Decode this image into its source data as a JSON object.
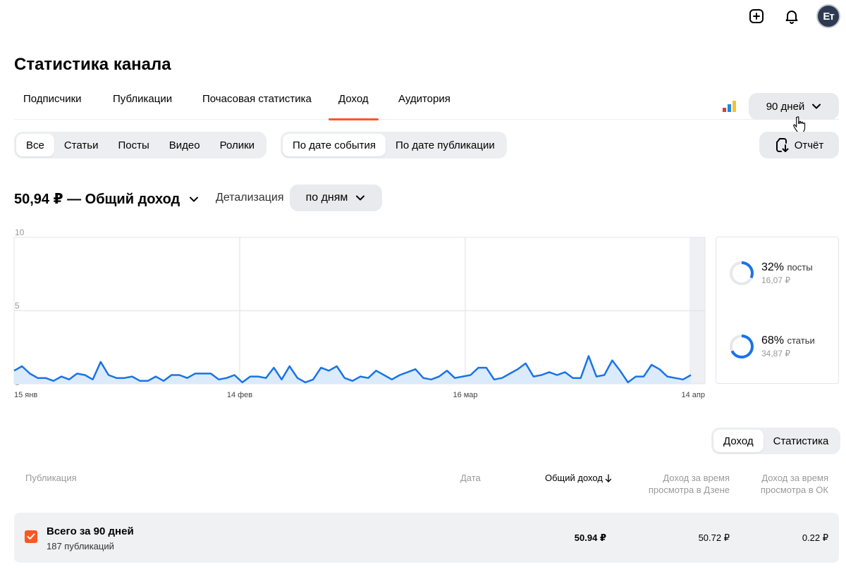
{
  "header": {
    "title": "Статистика канала",
    "avatar_initials": "Ет"
  },
  "tabs": [
    {
      "label": "Подписчики"
    },
    {
      "label": "Публикации"
    },
    {
      "label": "Почасовая статистика"
    },
    {
      "label": "Доход",
      "active": true
    },
    {
      "label": "Аудитория"
    }
  ],
  "period": {
    "label": "90 дней"
  },
  "content_filter": [
    "Все",
    "Статьи",
    "Посты",
    "Видео",
    "Ролики"
  ],
  "date_filter": [
    "По дате события",
    "По дате публикации"
  ],
  "report_button": "Отчёт",
  "income": {
    "title": "50,94 ₽ — Общий доход",
    "detail_label": "Детализация",
    "detail_value": "по дням"
  },
  "chart_data": {
    "type": "area",
    "ylim": [
      0,
      10
    ],
    "yticks": [
      "10",
      "5",
      "0"
    ],
    "xticks": [
      "15 янв",
      "14 фев",
      "16 мар",
      "14 апр"
    ],
    "colors": {
      "line": "#1a73e8",
      "fill": "#dcebfb"
    },
    "values": [
      0.9,
      1.2,
      0.7,
      0.4,
      0.4,
      0.2,
      0.5,
      0.3,
      0.7,
      0.6,
      0.3,
      1.5,
      0.6,
      0.4,
      0.4,
      0.5,
      0.2,
      0.2,
      0.5,
      0.2,
      0.6,
      0.6,
      0.4,
      0.7,
      0.7,
      0.7,
      0.3,
      0.4,
      0.6,
      0.1,
      0.5,
      0.5,
      0.4,
      1.1,
      0.3,
      1.2,
      0.4,
      0.1,
      0.3,
      1.1,
      0.9,
      1.2,
      0.4,
      0.2,
      0.5,
      0.4,
      0.9,
      0.6,
      0.3,
      0.6,
      0.8,
      1.0,
      0.4,
      0.3,
      0.5,
      0.9,
      0.4,
      0.5,
      0.6,
      1.1,
      1.1,
      0.3,
      0.4,
      0.7,
      1.0,
      1.4,
      0.5,
      0.6,
      0.8,
      0.6,
      0.8,
      0.4,
      0.4,
      1.9,
      0.5,
      0.6,
      1.6,
      0.9,
      0.1,
      0.5,
      0.5,
      1.3,
      1.0,
      0.5,
      0.4,
      0.3,
      0.6
    ]
  },
  "donuts": [
    {
      "pct": "32%",
      "label": "посты",
      "value": "16,07 ₽",
      "fraction": 0.32
    },
    {
      "pct": "68%",
      "label": "статьи",
      "value": "34,87 ₽",
      "fraction": 0.68
    }
  ],
  "view_toggle": [
    "Доход",
    "Статистика"
  ],
  "table": {
    "headers": {
      "publication": "Публикация",
      "date": "Дата",
      "total": "Общий доход",
      "dzen": [
        "Доход за время",
        "просмотра в Дзене"
      ],
      "ok": [
        "Доход за время",
        "просмотра в ОК"
      ]
    },
    "total_row": {
      "title": "Всего за 90 дней",
      "subtitle": "187 публикаций",
      "total": "50.94 ₽",
      "dzen": "50.72 ₽",
      "ok": "0.22 ₽"
    }
  },
  "accent": "#ff5722"
}
